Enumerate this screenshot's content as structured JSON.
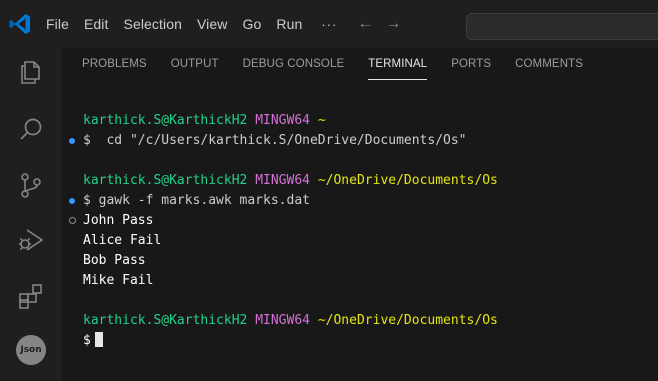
{
  "menu": {
    "items": [
      "File",
      "Edit",
      "Selection",
      "View",
      "Go",
      "Run"
    ],
    "more": "···",
    "back_arrow": "←",
    "forward_arrow": "→"
  },
  "activity": {
    "items": [
      "explorer-icon",
      "search-icon",
      "source-control-icon",
      "run-debug-icon",
      "extensions-icon"
    ],
    "json_badge": "Json"
  },
  "panel": {
    "tabs": [
      "PROBLEMS",
      "OUTPUT",
      "DEBUG CONSOLE",
      "TERMINAL",
      "PORTS",
      "COMMENTS"
    ],
    "active_tab": "TERMINAL"
  },
  "terminal": {
    "prompt1": {
      "user": "karthick.S@KarthickH2",
      "shell": "MINGW64",
      "path": "~"
    },
    "command1": "$  cd \"/c/Users/karthick.S/OneDrive/Documents/Os\"",
    "prompt2": {
      "user": "karthick.S@KarthickH2",
      "shell": "MINGW64",
      "path": "~/OneDrive/Documents/Os"
    },
    "command2": "$ gawk -f marks.awk marks.dat",
    "output": [
      "John Pass",
      "Alice Fail",
      "Bob Pass",
      "Mike Fail"
    ],
    "prompt3": {
      "user": "karthick.S@KarthickH2",
      "shell": "MINGW64",
      "path": "~/OneDrive/Documents/Os"
    },
    "current_prompt": "$"
  },
  "colors": {
    "user": "#23d18b",
    "shell": "#d670d6",
    "path": "#e5e510",
    "decoration_success": "#3794ff",
    "background": "#181818"
  }
}
